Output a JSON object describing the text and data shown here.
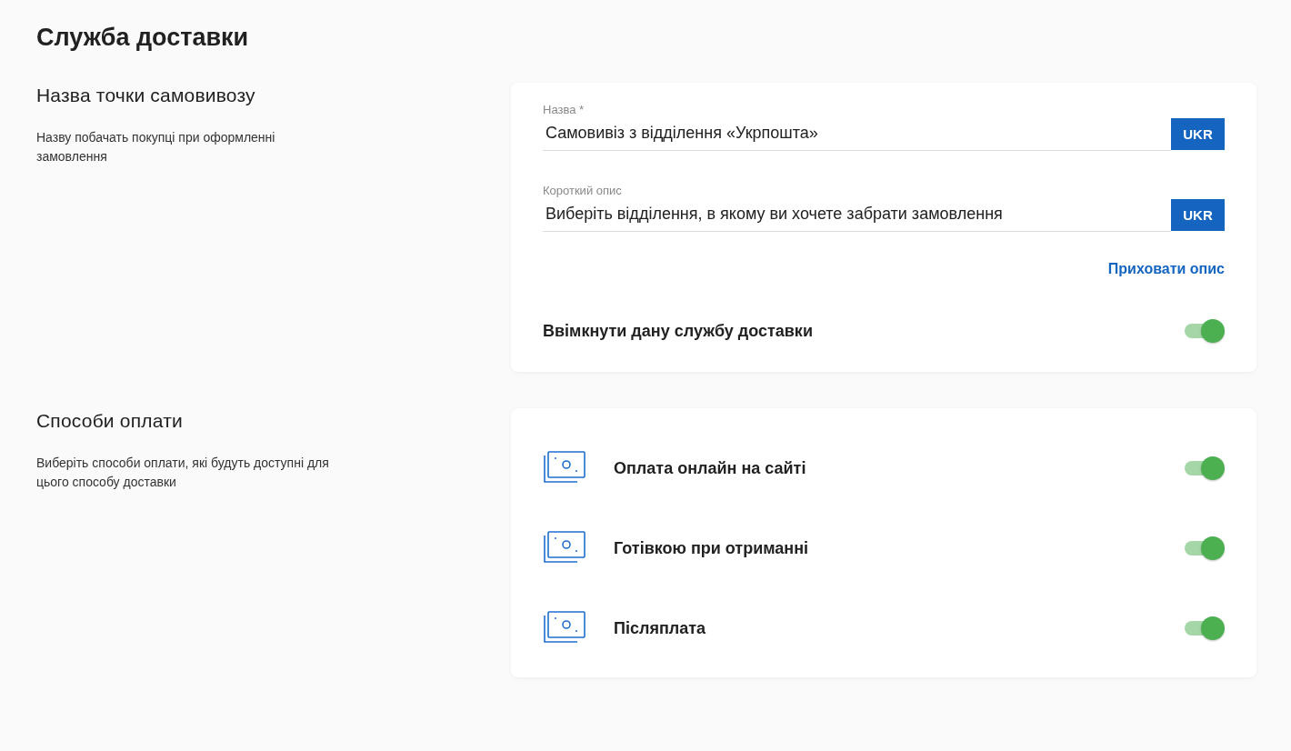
{
  "page_title": "Служба доставки",
  "sections": [
    {
      "title": "Назва точки самовивозу",
      "description": "Назву побачать покупці при оформленні замовлення",
      "fields": [
        {
          "label": "Назва *",
          "value": "Самовивіз з відділення «Укрпошта»",
          "language": "UKR"
        },
        {
          "label": "Короткий опис",
          "value": "Виберіть відділення, в якому ви хочете забрати замовлення",
          "language": "UKR"
        }
      ],
      "link": "Приховати опис",
      "toggles": [
        {
          "kind": "plain",
          "label": "Ввімкнути дану службу доставки",
          "on": true
        }
      ]
    },
    {
      "title": "Способи оплати",
      "description": "Виберіть способи оплати, які будуть доступні для цього способу доставки",
      "toggles": [
        {
          "kind": "payment",
          "label": "Оплата онлайн на сайті",
          "on": true
        },
        {
          "kind": "payment",
          "label": "Готівкою при отриманні",
          "on": true
        },
        {
          "kind": "payment",
          "label": "Післяплата",
          "on": true
        }
      ]
    }
  ]
}
